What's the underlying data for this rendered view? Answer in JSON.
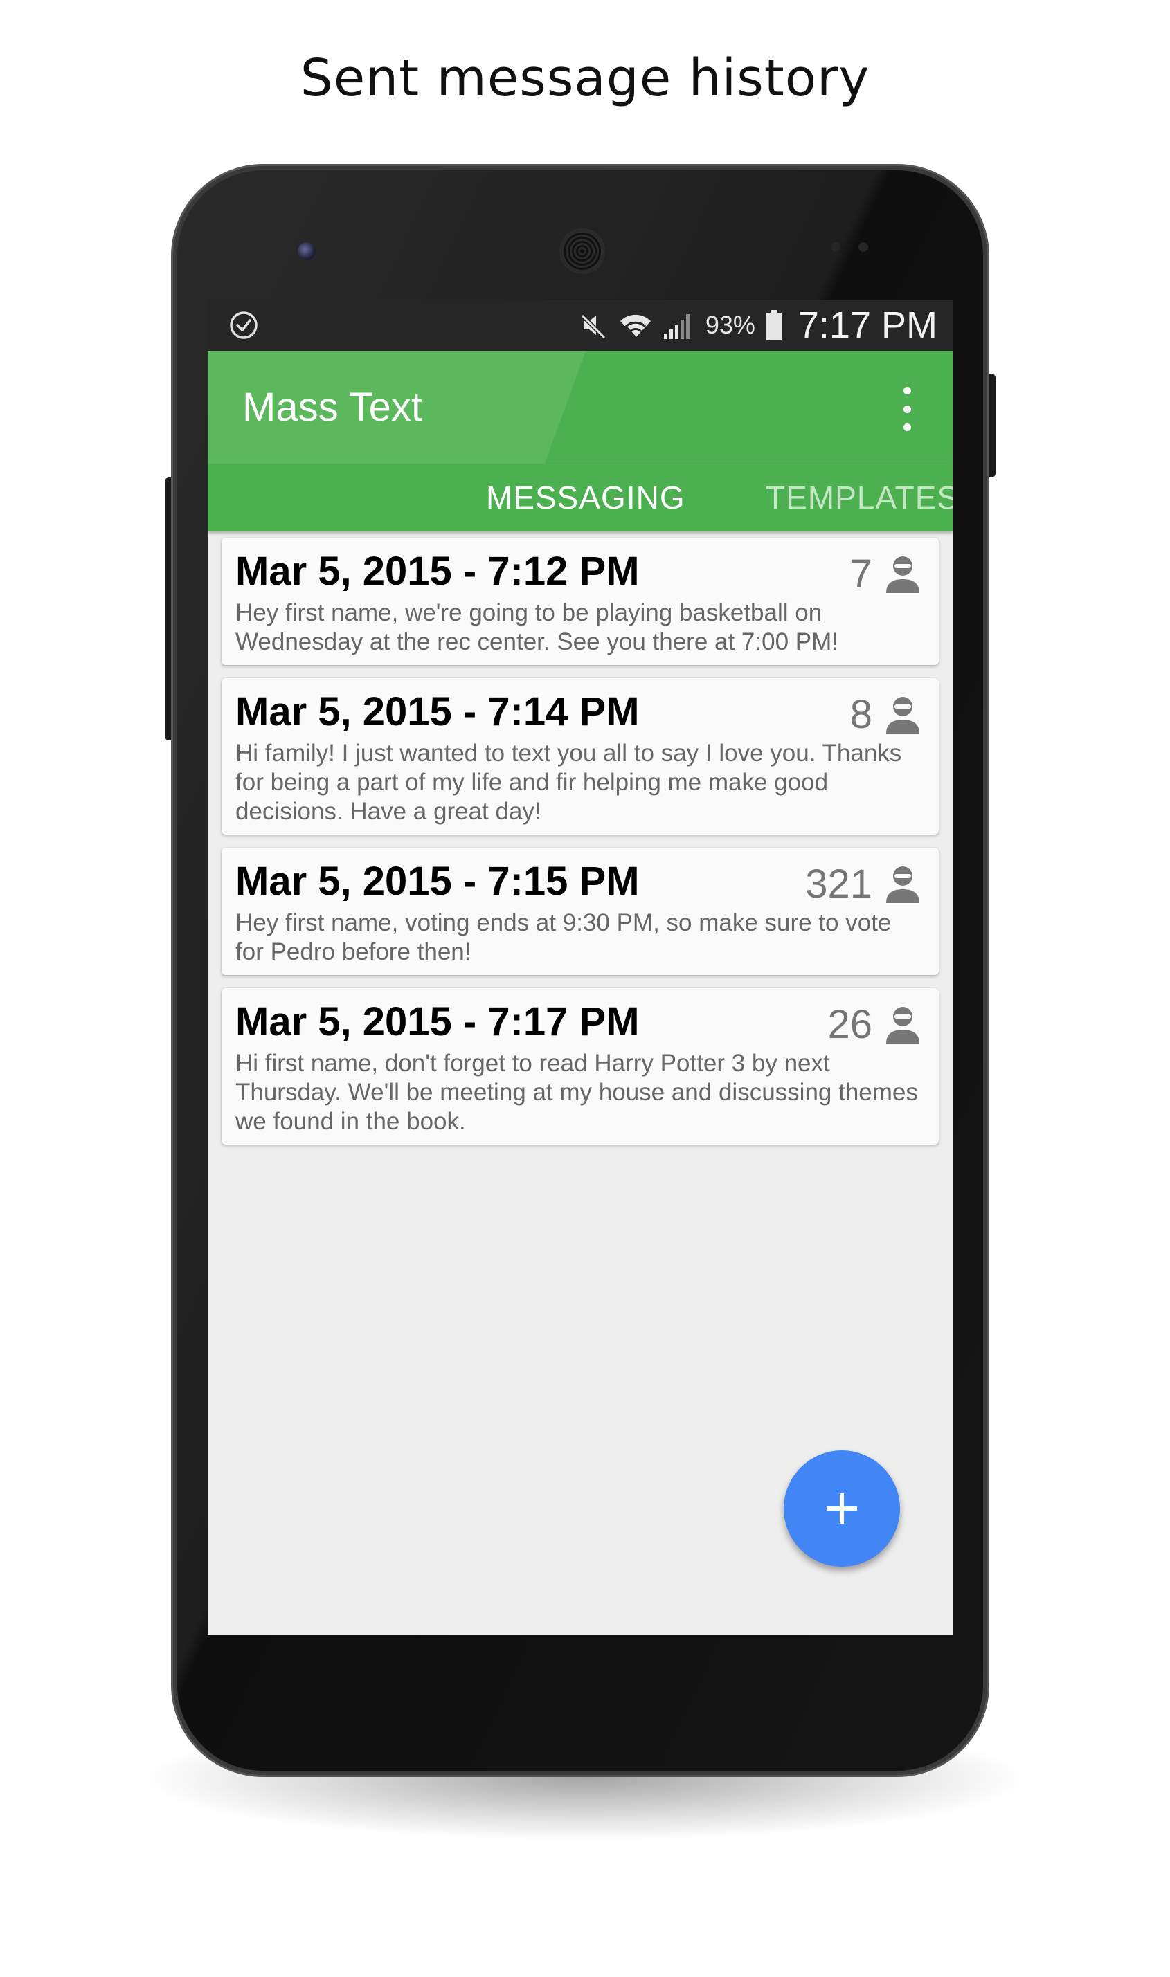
{
  "headline": "Sent message history",
  "status_bar": {
    "battery_percent": "93%",
    "time": "7:17 PM"
  },
  "app_bar": {
    "title": "Mass Text",
    "overflow_icon": "more-vert-icon"
  },
  "tabs": [
    {
      "label": "MESSAGING",
      "selected": true
    },
    {
      "label": "TEMPLATES",
      "selected": false
    }
  ],
  "messages": [
    {
      "date": "Mar 5, 2015 - 7:12 PM",
      "recipients": "7",
      "body": "Hey first name, we're going to be playing basketball on Wednesday at the rec center. See you there at 7:00 PM!"
    },
    {
      "date": "Mar 5, 2015 - 7:14 PM",
      "recipients": "8",
      "body": "Hi family! I just wanted to text you all to say I love you. Thanks for being a part of my life and fir helping me make good decisions. Have a great day!"
    },
    {
      "date": "Mar 5, 2015 - 7:15 PM",
      "recipients": "321",
      "body": "Hey first name, voting ends at 9:30 PM, so make sure to vote for Pedro before then!"
    },
    {
      "date": "Mar 5, 2015 - 7:17 PM",
      "recipients": "26",
      "body": "Hi first name, don't forget to read Harry Potter 3 by next Thursday. We'll be meeting at my house and discussing themes we found in the book."
    }
  ],
  "fab": {
    "icon": "plus-icon"
  },
  "colors": {
    "app_bar": "#4caf50",
    "fab": "#4285f4",
    "status_bar": "#262626"
  }
}
